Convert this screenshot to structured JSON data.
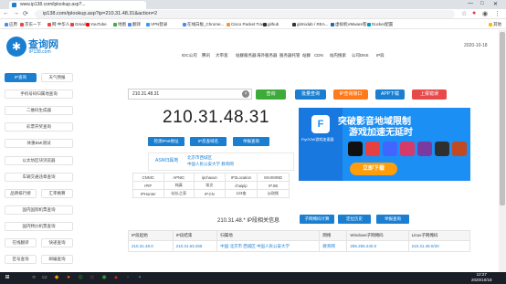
{
  "browser": {
    "tab_title": "www.ip138.com/iplookup.asp?...",
    "url": "ip138.com/iplookup.asp?ip=210.31.48.31&action=2",
    "bookmarks": [
      "应用",
      "京东一下",
      "网 中华人",
      "Gmail",
      "YouTube",
      "地图",
      "翻译",
      "VPN登录",
      "在线白板_Chrome...",
      "Cisco Packet Trac...",
      "github",
      "gitmixlab / REA...",
      "虚拟机VMware客...",
      "Docker配置",
      "其他"
    ]
  },
  "site": {
    "logo_text": "查询网",
    "logo_sub": "iP138.com",
    "date": "2020-10-18",
    "nav": [
      "IDC公司",
      "腾讯",
      "大带宽",
      "站群服务器",
      "海外服务器",
      "服务器托管",
      "站群",
      "CDN",
      "站内搜索",
      "公司DNS",
      "IP段"
    ]
  },
  "sidebar": {
    "items": [
      [
        "IP查询",
        "天气预报"
      ],
      [
        "手机号码归属地查询"
      ],
      [
        "二维码生成器"
      ],
      [
        "彩票开奖查询"
      ],
      [
        "体重BMI测试"
      ],
      [
        "以太坊区块浏览器"
      ],
      [
        "车辆交通违章查询"
      ],
      [
        "品牌排行榜",
        "汇率换算"
      ],
      [
        "国内国际机票查询"
      ],
      [
        "国内特价机票查询"
      ],
      [
        "在线翻译",
        "快递查询"
      ],
      [
        "区号查询",
        "邮编查询"
      ]
    ]
  },
  "search": {
    "value": "210.31.48.31",
    "clear_icon": "×",
    "buttons": [
      {
        "label": "查询",
        "color": "#3dab3a"
      },
      {
        "label": "批量查询",
        "color": "#1a7fd1"
      },
      {
        "label": "IP查询接口",
        "color": "#ff7a1a"
      },
      {
        "label": "APP下载",
        "color": "#1a7fd1"
      },
      {
        "label": "上报错误",
        "color": "#e84a4a"
      }
    ]
  },
  "result": {
    "ip": "210.31.48.31",
    "actions": [
      "检测IPv6地址",
      "IP反查域名",
      "举报查询"
    ],
    "asn_label": "ASN归属地",
    "location1": "北京市西城区",
    "location2": "中国人民公安大学 教育网",
    "grid": [
      [
        "CNNIC",
        "APNIC",
        "ipchaxun",
        "IP2Location",
        "MAXMIND"
      ],
      [
        "IPIP",
        "纯真",
        "埃文",
        "chaipip",
        "IP.SB"
      ],
      [
        "IPHunter",
        "站长之家",
        "IP.CN",
        "123查",
        "ip测频"
      ]
    ]
  },
  "banner": {
    "app_name": "FlyOOW游戏加速器",
    "headline1": "突破影音地域限制",
    "headline2": "游戏加速无延时",
    "download": "立即下载",
    "game_icons": [
      "#111",
      "#e64040",
      "#4066ff",
      "#d43a6a",
      "#7a3aa0",
      "#2f2f2f",
      "#c14a22"
    ]
  },
  "segment": {
    "heading": "210.31.48.* IP段相关信息",
    "buttons": [
      "子网掩码计算",
      "定位历史",
      "举报查询"
    ],
    "columns": [
      "IP段起始",
      "IP段结束",
      "归属地",
      "网络",
      "Windows子网掩码",
      "Linux子网掩码"
    ],
    "row": [
      "210.31.48.0",
      "210.31.63.255",
      "中国 北京市 西城区 中国人民公安大学",
      "教育网",
      "255.255.240.0",
      "210.31.48.0/20"
    ]
  },
  "taskbar": {
    "time": "12:27",
    "date": "2020/10/18"
  }
}
